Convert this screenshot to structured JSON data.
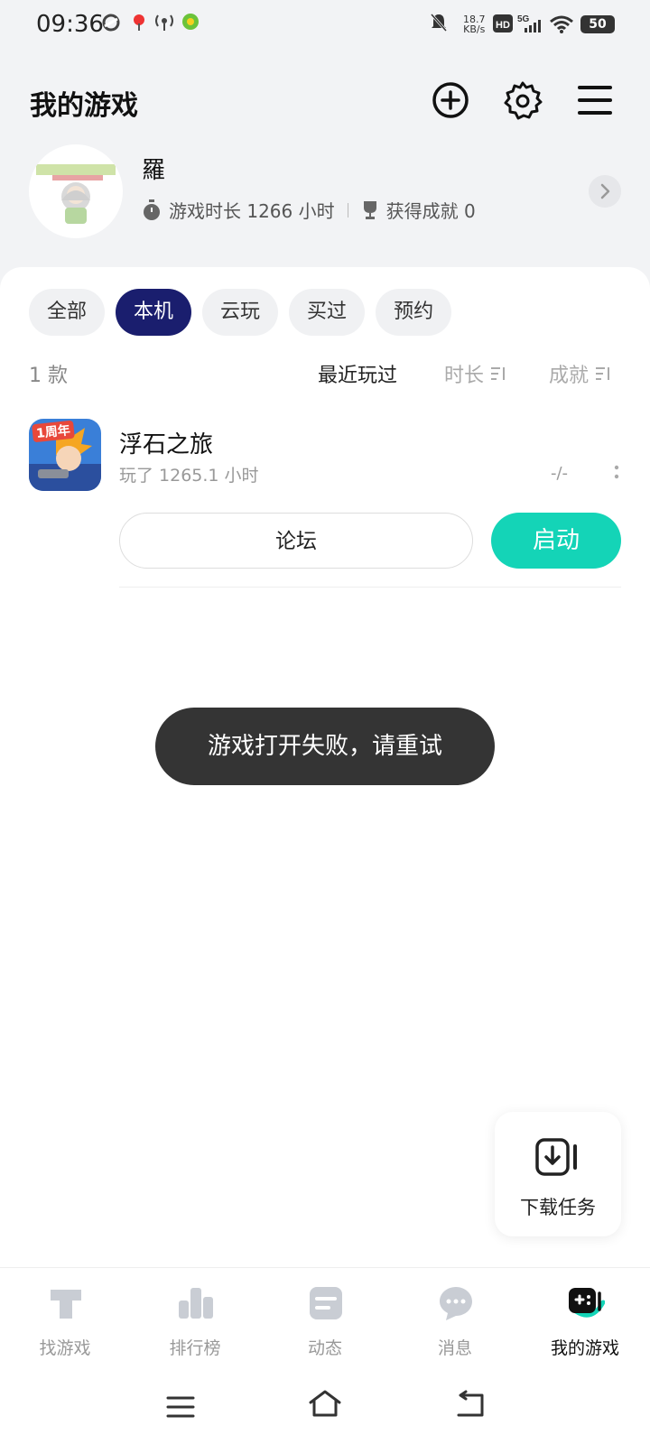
{
  "status_bar": {
    "time": "09:36",
    "speed_value": "18.7",
    "speed_unit": "KB/s",
    "battery": "50",
    "network": "5G"
  },
  "header": {
    "title": "我的游戏"
  },
  "profile": {
    "name": "羅",
    "play_time": "游戏时长 1266 小时",
    "achievements": "获得成就 0"
  },
  "tabs": [
    {
      "label": "全部",
      "active": false
    },
    {
      "label": "本机",
      "active": true
    },
    {
      "label": "云玩",
      "active": false
    },
    {
      "label": "买过",
      "active": false
    },
    {
      "label": "预约",
      "active": false
    }
  ],
  "list": {
    "count": "1 款",
    "sort_recent": "最近玩过",
    "sort_time": "时长",
    "sort_achievement": "成就"
  },
  "game": {
    "name": "浮石之旅",
    "played": "玩了 1265.1 小时",
    "achievement": "-/-",
    "icon_badge": "1周年",
    "forum_label": "论坛",
    "launch_label": "启动"
  },
  "toast": {
    "message": "游戏打开失败，请重试"
  },
  "download_task": {
    "label": "下载任务"
  },
  "bottom_nav": [
    {
      "label": "找游戏",
      "icon": "find-games-icon"
    },
    {
      "label": "排行榜",
      "icon": "rankings-icon"
    },
    {
      "label": "动态",
      "icon": "feed-icon"
    },
    {
      "label": "消息",
      "icon": "messages-icon"
    },
    {
      "label": "我的游戏",
      "icon": "my-games-icon",
      "active": true
    }
  ],
  "colors": {
    "accent": "#14d4b7",
    "tab_active": "#1a1e6e",
    "toast_bg": "#343434"
  }
}
